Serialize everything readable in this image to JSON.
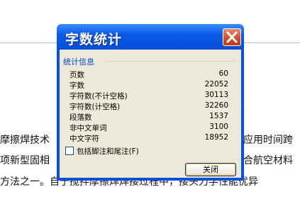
{
  "document": {
    "line1_left": "摩擦焊技术",
    "line1_right": "应用时间跨",
    "line2_left": "项新型固相",
    "line2_right": "合航空材料",
    "line3": "方法之一。自于搅拌摩擦焊焊接过程中，接头力学性能优异"
  },
  "dialog": {
    "title": "字数统计",
    "group_label": "统计信息",
    "stats": [
      {
        "label": "页数",
        "value": "60"
      },
      {
        "label": "字数",
        "value": "22052"
      },
      {
        "label": "字符数(不计空格)",
        "value": "30113"
      },
      {
        "label": "字符数(计空格)",
        "value": "32260"
      },
      {
        "label": "段落数",
        "value": "1537"
      },
      {
        "label": "非中文单词",
        "value": "3100"
      },
      {
        "label": "中文字符",
        "value": "18952"
      }
    ],
    "checkbox_label": "包括脚注和尾注(F)",
    "checkbox_checked": false,
    "close_label": "关闭"
  },
  "colors": {
    "titlebar": "#0a5ae8",
    "close_button": "#d24a28",
    "client_bg": "#ece9d8",
    "group_label": "#0046d5"
  }
}
